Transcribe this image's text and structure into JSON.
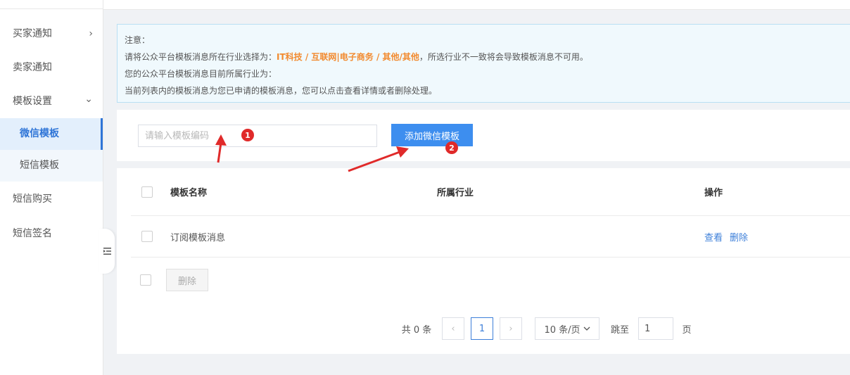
{
  "sidebar": {
    "items": [
      {
        "label": "买家通知",
        "chevron": "›"
      },
      {
        "label": "卖家通知"
      },
      {
        "label": "模板设置",
        "chevron": "⌄"
      },
      {
        "label": "短信购买"
      },
      {
        "label": "短信签名"
      }
    ],
    "sub_items": [
      {
        "label": "微信模板",
        "active": true
      },
      {
        "label": "短信模板"
      }
    ],
    "collapse_icon": "indent-icon"
  },
  "notice": {
    "line1": "注意：",
    "line2_prefix": "请将公众平台模板消息所在行业选择为：",
    "line2_highlight": "IT科技 / 互联网|电子商务 / 其他/其他",
    "line2_suffix": "，所选行业不一致将会导致模板消息不可用。",
    "line3": "您的公众平台模板消息目前所属行业为：",
    "line4": "当前列表内的模板消息为您已申请的模板消息，您可以点击查看详情或者删除处理。"
  },
  "search": {
    "placeholder": "请输入模板编码",
    "value": ""
  },
  "toolbar": {
    "add_label": "添加微信模板"
  },
  "table": {
    "columns": [
      "模板名称",
      "所属行业",
      "操作"
    ],
    "rows": [
      {
        "name": "订阅模板消息",
        "industry": "",
        "actions": [
          "查看",
          "删除"
        ]
      }
    ],
    "bulk_delete_label": "删除"
  },
  "pagination": {
    "total": "共 0 条",
    "prev": "‹",
    "current": "1",
    "next": "›",
    "page_size": "10 条/页",
    "jump_label": "跳至",
    "jump_value": "1",
    "page_suffix": "页"
  },
  "annotations": {
    "badge1": "1",
    "badge2": "2"
  },
  "colors": {
    "primary": "#3d8eef",
    "highlight": "#f28a2e",
    "annotation": "#e02a2a"
  }
}
